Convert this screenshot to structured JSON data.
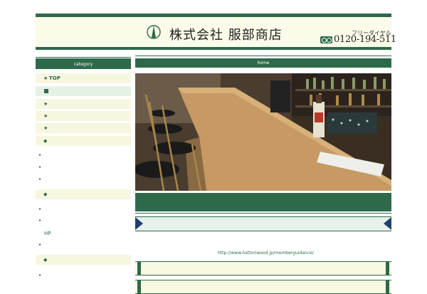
{
  "header": {
    "company_name": "株式会社 服部商店",
    "free_dial_label": "フリーダイヤル",
    "free_dial_number": "0120-194-511"
  },
  "sidebar": {
    "heading": "category",
    "items": [
      {
        "marker": "★",
        "label": "TOP"
      },
      {
        "marker": "■",
        "label": ""
      },
      {
        "marker": "★",
        "label": ""
      },
      {
        "marker": "★",
        "label": ""
      },
      {
        "marker": "★",
        "label": ""
      },
      {
        "marker": "◆",
        "label": ""
      },
      {
        "marker": "◆",
        "label": ""
      },
      {
        "marker": "◆",
        "label": ""
      }
    ],
    "bullet": "•",
    "hp_label": "HP"
  },
  "main": {
    "heading": "home",
    "photo_alt": "bar counter interior",
    "url_text": "http://www.hattoriwood.jp/memberguidance/"
  },
  "colors": {
    "brand_green": "#2e6a4a",
    "cream": "#fafbe8",
    "navy": "#1f3f6e"
  }
}
